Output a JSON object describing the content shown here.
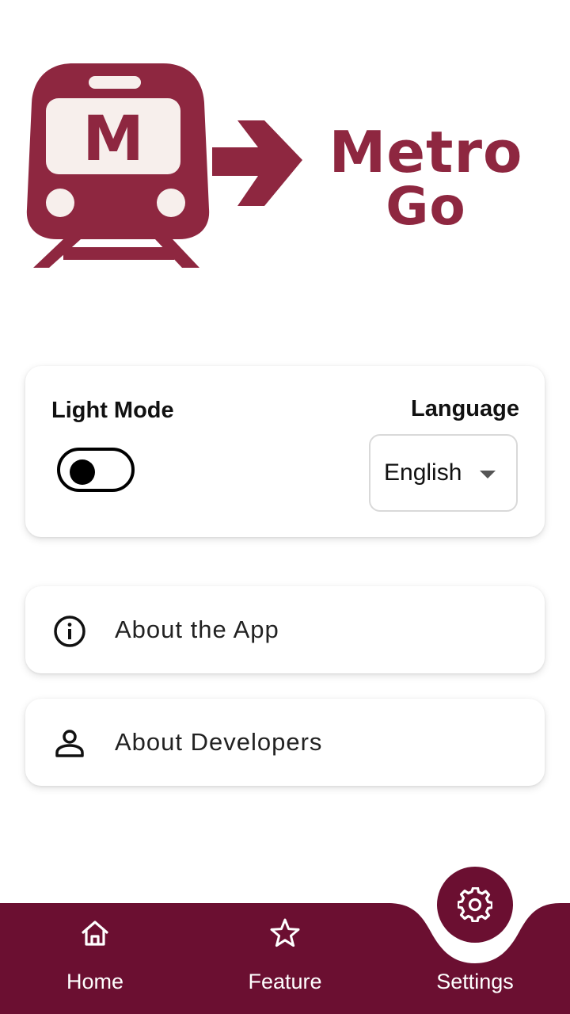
{
  "logo": {
    "badge_letter": "M",
    "brand_line1": "Metro",
    "brand_line2": "Go"
  },
  "settings_card": {
    "mode_label": "Light Mode",
    "dark_mode_enabled": false,
    "language_label": "Language",
    "language_value": "English"
  },
  "menu": {
    "about_app": "About the App",
    "about_developers": "About Developers"
  },
  "bottom_nav": {
    "home": "Home",
    "feature": "Feature",
    "settings": "Settings",
    "active": "Settings"
  },
  "colors": {
    "brand": "#8e2740",
    "nav_background": "#6b0f31",
    "white": "#ffffff"
  },
  "icons": {
    "menu_about_app": "info-icon",
    "menu_about_developers": "person-icon",
    "nav_home": "home-icon",
    "nav_feature": "star-icon",
    "nav_settings": "gear-icon"
  }
}
